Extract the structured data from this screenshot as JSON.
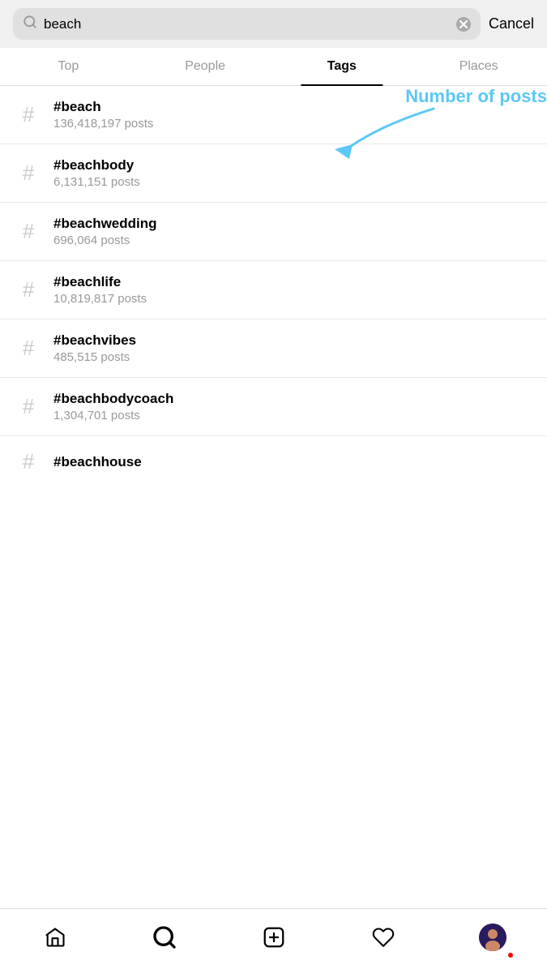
{
  "search": {
    "value": "beach",
    "placeholder": "Search",
    "clear_icon": "×"
  },
  "cancel_label": "Cancel",
  "tabs": [
    {
      "id": "top",
      "label": "Top",
      "active": false
    },
    {
      "id": "people",
      "label": "People",
      "active": false
    },
    {
      "id": "tags",
      "label": "Tags",
      "active": true
    },
    {
      "id": "places",
      "label": "Places",
      "active": false
    }
  ],
  "annotation": {
    "text": "Number of posts"
  },
  "tags": [
    {
      "name": "#beach",
      "posts": "136,418,197 posts"
    },
    {
      "name": "#beachbody",
      "posts": "6,131,151 posts"
    },
    {
      "name": "#beachwedding",
      "posts": "696,064 posts"
    },
    {
      "name": "#beachlife",
      "posts": "10,819,817 posts"
    },
    {
      "name": "#beachvibes",
      "posts": "485,515 posts"
    },
    {
      "name": "#beachbodycoach",
      "posts": "1,304,701 posts"
    },
    {
      "name": "#beachhouse",
      "posts": ""
    }
  ],
  "bottom_nav": {
    "home_icon": "⌂",
    "search_icon": "🔍",
    "add_icon": "+",
    "heart_icon": "♡",
    "avatar_label": "avatar"
  }
}
